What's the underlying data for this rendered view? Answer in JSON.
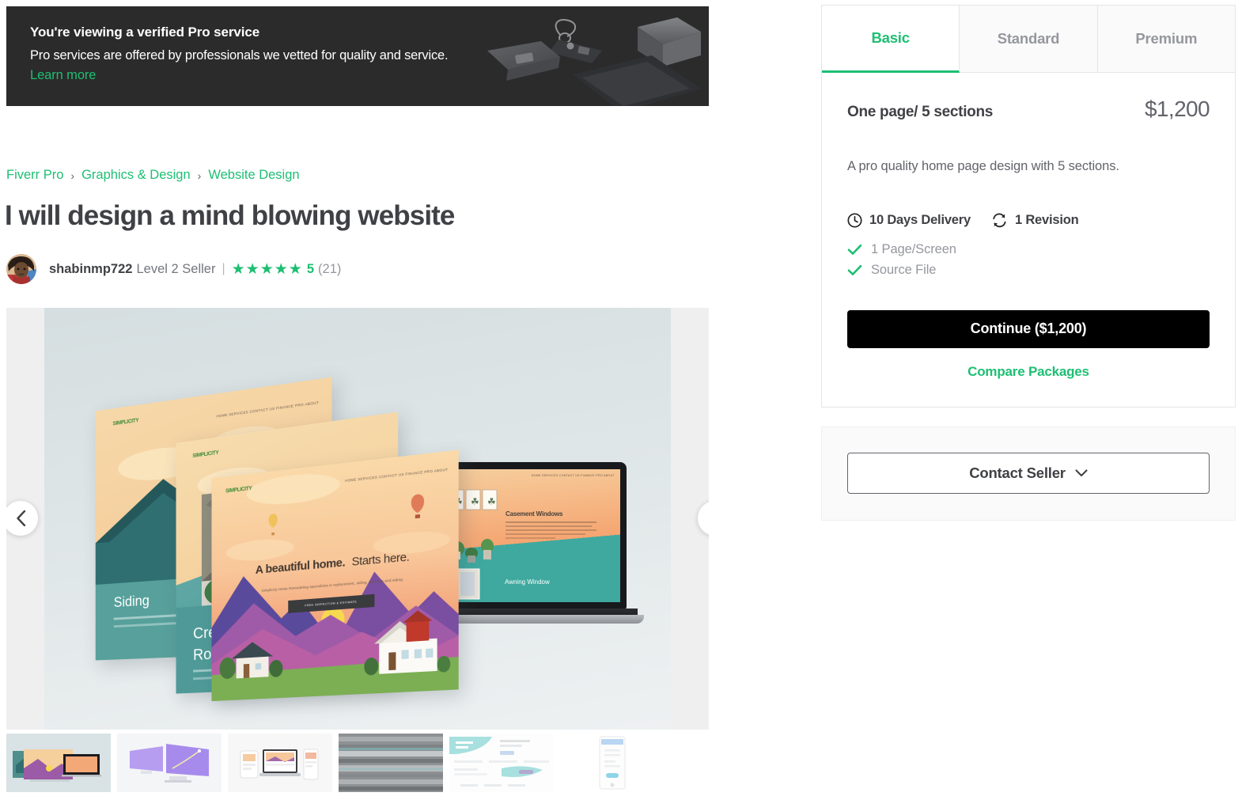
{
  "pro_banner": {
    "title": "You're viewing a verified Pro service",
    "subtitle": "Pro services are offered by professionals we vetted for quality and service.",
    "learn_more": "Learn more",
    "background_color": "#2b2b2b",
    "accent_color": "#1dbf73"
  },
  "breadcrumb": {
    "items": [
      {
        "label": "Fiverr Pro"
      },
      {
        "label": "Graphics & Design"
      },
      {
        "label": "Website Design"
      }
    ],
    "separator": "›"
  },
  "gig": {
    "title": "I will design a mind blowing website"
  },
  "seller": {
    "name": "shabinmp722",
    "level": "Level 2 Seller",
    "divider": "|",
    "stars": 5,
    "star_glyph": "★",
    "rating": "5",
    "reviews_count": "(21)",
    "avatar_name": "seller-avatar"
  },
  "gallery": {
    "prev_label": "Previous slide",
    "next_label": "Next slide",
    "slide_texts": {
      "headline_bold": "A beautiful home.",
      "headline_light": "Starts here.",
      "sub": "Simplicity Home Remodeling specializes in replacement, siding, windows and siding",
      "cta": "FREE INSPECTION & ESTIMATE",
      "card1_title": "Siding",
      "card2_title_a": "Create",
      "card2_title_b": "Roof",
      "laptop_title": "Casement Windows",
      "laptop_sub_title": "Awning Window",
      "nav_items": "HOME   SERVICES   CONTACT US   FINANCE   PRO   ABOUT",
      "logo": "SIMPLICITY"
    },
    "thumbnails": [
      {
        "name": "thumb-1-website-mockups",
        "selected": true
      },
      {
        "name": "thumb-2-dual-monitors",
        "selected": false
      },
      {
        "name": "thumb-3-responsive-devices",
        "selected": false
      },
      {
        "name": "thumb-4-blurred-preview",
        "selected": false
      },
      {
        "name": "thumb-5-landing-page",
        "selected": false
      },
      {
        "name": "thumb-6-mobile-app",
        "selected": false
      }
    ]
  },
  "packages": {
    "tabs": [
      {
        "label": "Basic",
        "active": true
      },
      {
        "label": "Standard",
        "active": false
      },
      {
        "label": "Premium",
        "active": false
      }
    ],
    "active": {
      "name": "One page/ 5 sections",
      "price": "$1,200",
      "description": "A pro quality home page design with 5 sections.",
      "delivery": "10 Days Delivery",
      "revisions": "1 Revision",
      "features": [
        "1 Page/Screen",
        "Source File"
      ]
    },
    "continue_label": "Continue ($1,200)",
    "compare_label": "Compare Packages"
  },
  "contact": {
    "label": "Contact Seller",
    "chevron": "⌄"
  },
  "colors": {
    "brand_green": "#1dbf73",
    "text_dark": "#404145",
    "text_muted": "#62646a",
    "text_light": "#95979d",
    "border": "#e4e5e7",
    "panel_bg": "#fafafa",
    "gallery_bg": "#efeff0",
    "cta_black": "#000000"
  }
}
